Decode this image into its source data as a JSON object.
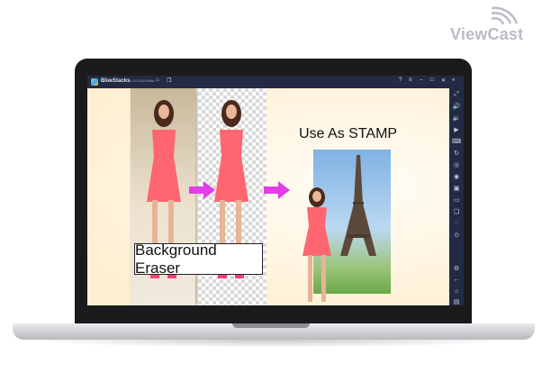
{
  "brand": {
    "logo_text": "ViewCast"
  },
  "window": {
    "app_title": "BlueStacks",
    "version": "5.0.0.1024 Beta",
    "controls": [
      "help-icon",
      "menu-icon",
      "minimize-icon",
      "maximize-icon",
      "close-icon",
      "collapse-icon"
    ]
  },
  "app": {
    "label_background_eraser": "Background Eraser",
    "label_use_as_stamp": "Use As STAMP"
  },
  "sidebar_icons": [
    "expand-icon",
    "volume-up-icon",
    "volume-down-icon",
    "video-icon",
    "keyboard-icon",
    "rotate-icon",
    "gamepad-icon",
    "camera-icon",
    "screenshot-icon",
    "folder-icon",
    "copy-icon",
    "eco-icon",
    "location-icon",
    "settings-icon",
    "back-icon",
    "home-icon",
    "recent-apps-icon"
  ],
  "colors": {
    "titlebar": "#232a44",
    "arrow": "#e23ee6",
    "dress": "#ff6670"
  }
}
